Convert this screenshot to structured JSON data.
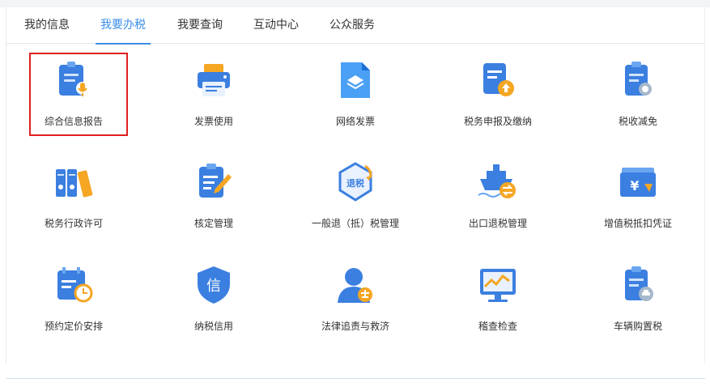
{
  "tabs": [
    {
      "label": "我的信息",
      "active": false
    },
    {
      "label": "我要办税",
      "active": true
    },
    {
      "label": "我要查询",
      "active": false
    },
    {
      "label": "互动中心",
      "active": false
    },
    {
      "label": "公众服务",
      "active": false
    }
  ],
  "items": [
    {
      "label": "综合信息报告",
      "icon": "report-mic-icon",
      "highlighted": true
    },
    {
      "label": "发票使用",
      "icon": "printer-icon"
    },
    {
      "label": "网络发票",
      "icon": "network-invoice-icon"
    },
    {
      "label": "税务申报及缴纳",
      "icon": "tax-declare-upload-icon"
    },
    {
      "label": "税收减免",
      "icon": "tax-relief-icon"
    },
    {
      "label": "税务行政许可",
      "icon": "binders-icon"
    },
    {
      "label": "核定管理",
      "icon": "clipboard-edit-icon"
    },
    {
      "label": "一般退（抵）税管理",
      "icon": "tax-refund-shield-icon"
    },
    {
      "label": "出口退税管理",
      "icon": "export-ship-icon"
    },
    {
      "label": "增值税抵扣凭证",
      "icon": "vat-voucher-icon"
    },
    {
      "label": "预约定价安排",
      "icon": "calendar-clock-icon"
    },
    {
      "label": "纳税信用",
      "icon": "credit-shield-icon"
    },
    {
      "label": "法律追责与救济",
      "icon": "legal-person-icon"
    },
    {
      "label": "稽查检查",
      "icon": "monitor-chart-icon"
    },
    {
      "label": "车辆购置税",
      "icon": "vehicle-tax-icon"
    }
  ],
  "icon_text": {
    "refund": "退税",
    "credit": "信",
    "yen": "¥"
  },
  "colors": {
    "accent": "#3a8ee6",
    "icon_blue": "#3b7fe0",
    "icon_orange": "#f5a623",
    "highlight": "#e02020"
  }
}
